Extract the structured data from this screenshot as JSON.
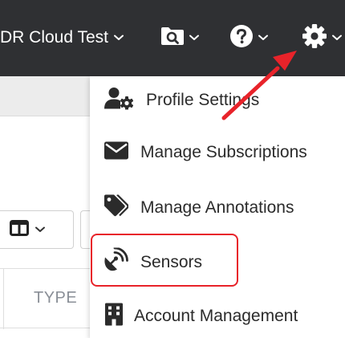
{
  "topbar": {
    "org_name": "DR Cloud Test",
    "icons": [
      "search-folder-icon",
      "help-icon",
      "gear-icon"
    ]
  },
  "page": {
    "table_header": {
      "type_column": "TYPE"
    }
  },
  "settings_menu": {
    "items": [
      {
        "label": "Profile Settings",
        "icon": "user-cog-icon"
      },
      {
        "label": "Manage Subscriptions",
        "icon": "envelope-icon"
      },
      {
        "label": "Manage Annotations",
        "icon": "tags-icon"
      },
      {
        "label": "Sensors",
        "icon": "satellite-dish-icon"
      },
      {
        "label": "Account Management",
        "icon": "building-icon"
      }
    ]
  },
  "annotation": {
    "highlight_color": "#e8232a",
    "arrow_color": "#e8232a"
  },
  "colors": {
    "topbar_bg": "#2f3033",
    "menu_text": "#2b2b2b",
    "column_header_text": "#8a8f97"
  }
}
